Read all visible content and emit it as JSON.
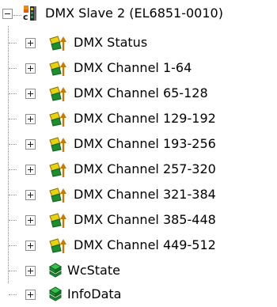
{
  "tree": {
    "root": {
      "label": "DMX Slave 2 (EL6851-0010)",
      "icon": "ethercat-terminal-icon",
      "expanded": true
    },
    "children": [
      {
        "label": "DMX Status",
        "icon": "output-channel-icon",
        "expanded": false
      },
      {
        "label": "DMX Channel 1-64",
        "icon": "output-channel-icon",
        "expanded": false
      },
      {
        "label": "DMX Channel 65-128",
        "icon": "output-channel-icon",
        "expanded": false
      },
      {
        "label": "DMX Channel 129-192",
        "icon": "output-channel-icon",
        "expanded": false
      },
      {
        "label": "DMX Channel 193-256",
        "icon": "output-channel-icon",
        "expanded": false
      },
      {
        "label": "DMX Channel 257-320",
        "icon": "output-channel-icon",
        "expanded": false
      },
      {
        "label": "DMX Channel 321-384",
        "icon": "output-channel-icon",
        "expanded": false
      },
      {
        "label": "DMX Channel 385-448",
        "icon": "output-channel-icon",
        "expanded": false
      },
      {
        "label": "DMX Channel 449-512",
        "icon": "output-channel-icon",
        "expanded": false
      },
      {
        "label": "WcState",
        "icon": "green-variable-icon",
        "expanded": false
      },
      {
        "label": "InfoData",
        "icon": "green-variable-icon",
        "expanded": false
      }
    ]
  },
  "colors": {
    "connector": "#8c8c8c",
    "expander_border": "#8f8f8f",
    "text": "#000000",
    "terminal_orange": "#f08a00",
    "terminal_green": "#1fa23a",
    "output_yellow": "#e8d20e",
    "output_arrow": "#c97a00",
    "variable_green": "#1b8f2e"
  }
}
